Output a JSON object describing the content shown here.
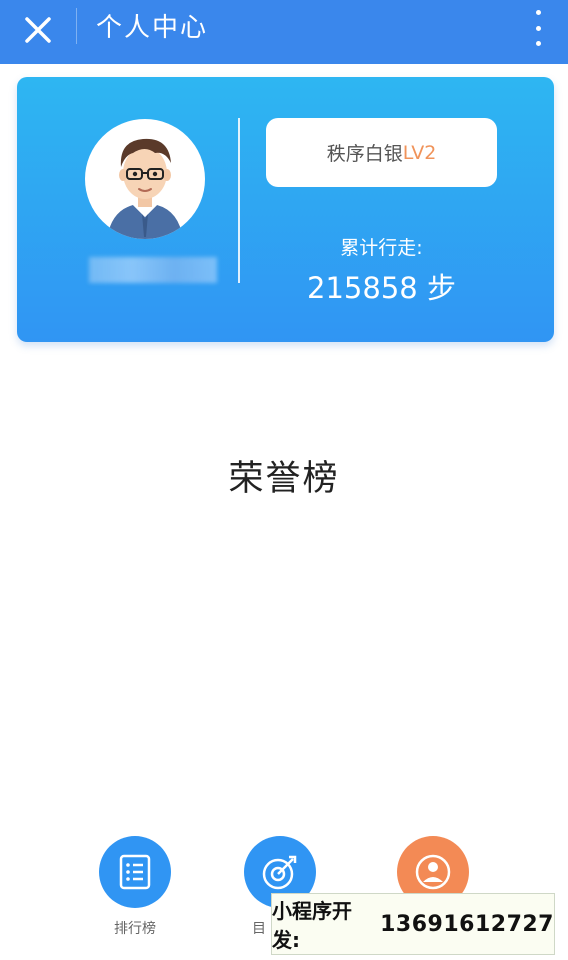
{
  "header": {
    "title": "个人中心",
    "close_icon": "close-icon",
    "more_icon": "more-vertical-icon"
  },
  "profile": {
    "avatar_icon": "cartoon-avatar",
    "level_prefix": "秩序白银",
    "level_code": "LV2",
    "steps_label": "累计行走:",
    "steps_value": "215858 步"
  },
  "honor": {
    "title": "荣誉榜"
  },
  "bottom_nav": [
    {
      "label": "排行榜",
      "icon": "list-icon"
    },
    {
      "label": "目",
      "icon": "target-icon"
    },
    {
      "label": "",
      "icon": "user-icon"
    }
  ],
  "banner": {
    "prefix": "小程序开发:",
    "phone": "13691612727"
  },
  "colors": {
    "header": "#3a87ec",
    "card_top": "#2eb6f2",
    "card_bottom": "#3095f3",
    "level_accent": "#f0935a",
    "nav_blue": "#3095f3",
    "nav_orange": "#f38a55"
  }
}
